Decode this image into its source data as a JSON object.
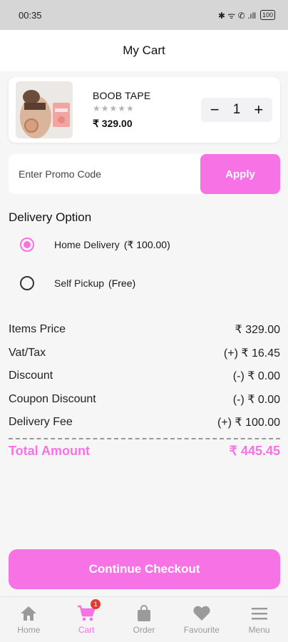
{
  "status_bar": {
    "time": "00:35",
    "icons_text": "✱ ᯤ ✆ .ıll",
    "battery": "100"
  },
  "header": {
    "title": "My Cart"
  },
  "cart_item": {
    "name": "BOOB TAPE",
    "rating_stars": "★★★★★",
    "price": "₹ 329.00",
    "quantity": "1",
    "minus": "−",
    "plus": "+"
  },
  "promo": {
    "placeholder": "Enter Promo Code",
    "apply_label": "Apply"
  },
  "delivery": {
    "title": "Delivery Option",
    "options": [
      {
        "label": "Home Delivery",
        "extra": "(₹ 100.00)",
        "selected": true
      },
      {
        "label": "Self Pickup",
        "extra": "(Free)",
        "selected": false
      }
    ]
  },
  "summary": {
    "rows": [
      {
        "label": "Items Price",
        "value": "₹ 329.00"
      },
      {
        "label": "Vat/Tax",
        "value": "(+) ₹ 16.45"
      },
      {
        "label": "Discount",
        "value": "(-) ₹ 0.00"
      },
      {
        "label": "Coupon Discount",
        "value": "(-) ₹ 0.00"
      },
      {
        "label": "Delivery Fee",
        "value": "(+) ₹ 100.00"
      }
    ],
    "total_label": "Total Amount",
    "total_value": "₹ 445.45"
  },
  "checkout_label": "Continue Checkout",
  "nav": {
    "items": [
      {
        "label": "Home",
        "icon": "home-icon"
      },
      {
        "label": "Cart",
        "icon": "cart-icon",
        "badge": "1"
      },
      {
        "label": "Order",
        "icon": "bag-icon"
      },
      {
        "label": "Favourite",
        "icon": "heart-icon"
      },
      {
        "label": "Menu",
        "icon": "menu-icon"
      }
    ]
  },
  "colors": {
    "accent": "#f772e4",
    "badge": "#e43a2f"
  }
}
